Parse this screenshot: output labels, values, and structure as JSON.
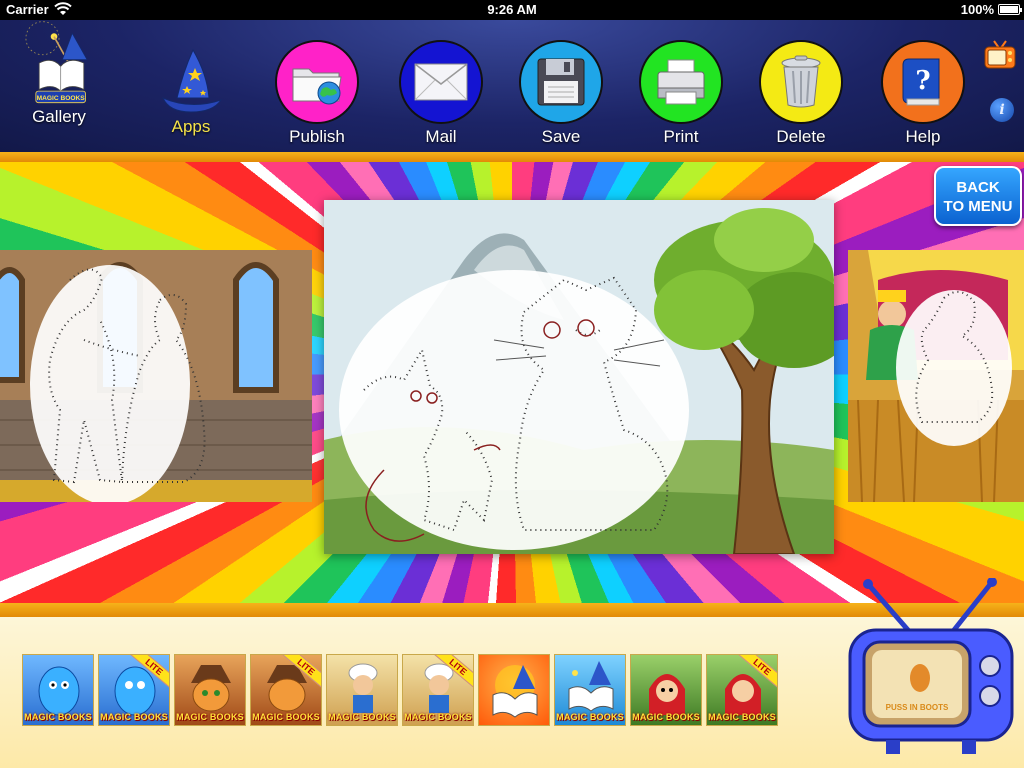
{
  "status_bar": {
    "carrier": "Carrier",
    "time": "9:26 AM",
    "battery": "100%"
  },
  "toolbar": {
    "gallery": {
      "label": "Gallery",
      "icon": "magic-book-wand-icon",
      "logo_text": "MAGIC BOOKS"
    },
    "apps": {
      "label": "Apps",
      "icon": "wizard-hat-icon"
    },
    "publish": {
      "label": "Publish",
      "icon": "folder-globe-icon",
      "color": "#ff22c8"
    },
    "mail": {
      "label": "Mail",
      "icon": "envelope-icon",
      "color": "#1414d2"
    },
    "save": {
      "label": "Save",
      "icon": "floppy-disk-icon",
      "color": "#1fa6e8"
    },
    "print": {
      "label": "Print",
      "icon": "printer-icon",
      "color": "#22e422"
    },
    "delete": {
      "label": "Delete",
      "icon": "trash-can-icon",
      "color": "#f4ea14"
    },
    "help": {
      "label": "Help",
      "icon": "question-book-icon",
      "color": "#f2711c"
    },
    "tv": {
      "icon": "retro-tv-icon"
    },
    "info": {
      "label": "i",
      "icon": "info-icon"
    }
  },
  "stage": {
    "back_button": {
      "line1": "BACK",
      "line2": "TO MENU"
    },
    "pages": [
      {
        "name": "prince-princess-castle",
        "role": "previous"
      },
      {
        "name": "cat-mouse-mountain-tree",
        "role": "current"
      },
      {
        "name": "king-wheat-field",
        "role": "next"
      }
    ]
  },
  "apps_row": {
    "tiles": [
      {
        "label": "MAGIC BOOKS",
        "lite": false,
        "color": "#3a7fd9",
        "art": "blue-genie"
      },
      {
        "label": "MAGIC BOOKS",
        "lite": true,
        "color": "#3a7fd9",
        "art": "blue-genie"
      },
      {
        "label": "MAGIC BOOKS",
        "lite": false,
        "color": "#c96b2a",
        "art": "puss-in-boots"
      },
      {
        "label": "MAGIC BOOKS",
        "lite": true,
        "color": "#c96b2a",
        "art": "puss-in-boots"
      },
      {
        "label": "MAGIC BOOKS",
        "lite": false,
        "color": "#d9b25a",
        "art": "aladdin"
      },
      {
        "label": "MAGIC BOOKS",
        "lite": true,
        "color": "#d9b25a",
        "art": "aladdin"
      },
      {
        "label": "",
        "lite": false,
        "color": "#ff6a12",
        "art": "magic-books-book"
      },
      {
        "label": "MAGIC BOOKS",
        "lite": false,
        "color": "#2a9be6",
        "art": "magic-books-book"
      },
      {
        "label": "MAGIC BOOKS",
        "lite": false,
        "color": "#5a8a3a",
        "art": "red-riding-hood"
      },
      {
        "label": "MAGIC BOOKS",
        "lite": true,
        "color": "#5a8a3a",
        "art": "red-riding-hood"
      }
    ],
    "lite_text": "LITE"
  },
  "tv_large": {
    "screen_text": "PUSS IN BOOTS",
    "icon": "retro-tv-icon"
  }
}
